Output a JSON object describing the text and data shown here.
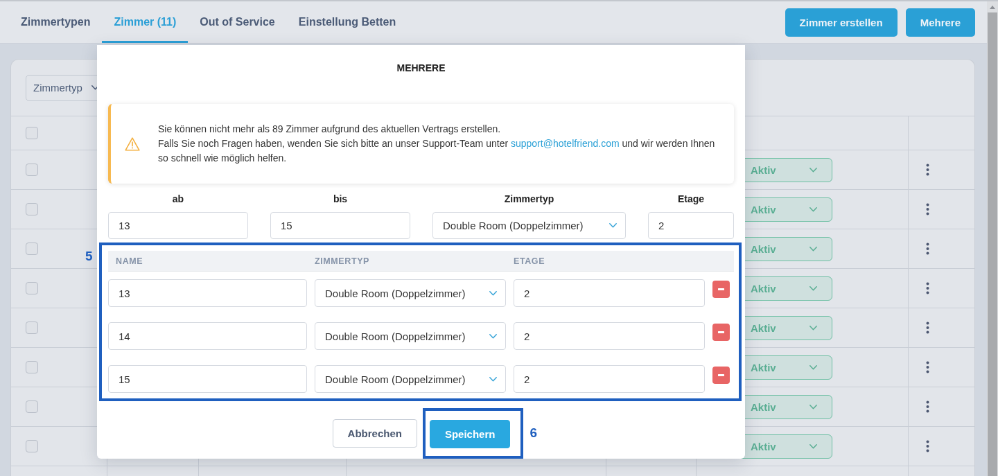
{
  "tabs": [
    {
      "label": "Zimmertypen",
      "selected": false
    },
    {
      "label": "Zimmer (11)",
      "selected": true
    },
    {
      "label": "Out of Service",
      "selected": false
    },
    {
      "label": "Einstellung Betten",
      "selected": false
    }
  ],
  "header_buttons": [
    {
      "label": "Zimmer erstellen"
    },
    {
      "label": "Mehrere"
    }
  ],
  "filter": {
    "label": "Zimmertyp"
  },
  "table": {
    "header_checkbox": {
      "checked": false
    },
    "rows": [
      {
        "checked": false,
        "status": "Aktiv"
      },
      {
        "checked": false,
        "status": "Aktiv"
      },
      {
        "checked": false,
        "status": "Aktiv"
      },
      {
        "checked": false,
        "status": "Aktiv"
      },
      {
        "checked": false,
        "status": "Aktiv"
      },
      {
        "checked": false,
        "status": "Aktiv"
      },
      {
        "checked": false,
        "status": "Aktiv"
      },
      {
        "checked": false,
        "status": "Aktiv"
      }
    ]
  },
  "dialog": {
    "title": "MEHRERE",
    "alert": {
      "message": "Sie können nicht mehr als 89 Zimmer aufgrund des aktuellen Vertrags erstellen.",
      "note": {
        "before": "Falls Sie noch Fragen haben, wenden Sie sich bitte an unser Support-Team unter",
        "link": "support@hotelfriend.com",
        "after": "und wir werden Ihnen so schnell wie möglich helfen."
      }
    },
    "range": [
      {
        "label": "ab",
        "value": "13",
        "kind": "input"
      },
      {
        "label": "bis",
        "value": "15",
        "kind": "input"
      },
      {
        "label": "Zimmertyp",
        "value": "Double Room (Doppelzimmer)",
        "kind": "select"
      },
      {
        "label": "Etage",
        "value": "2",
        "kind": "input"
      }
    ],
    "rooms": {
      "columns": [
        "NAME",
        "ZIMMERTYP",
        "ETAGE"
      ],
      "rows": [
        {
          "name": "13",
          "room_type": "Double Room (Doppelzimmer)",
          "floor": "2"
        },
        {
          "name": "14",
          "room_type": "Double Room (Doppelzimmer)",
          "floor": "2"
        },
        {
          "name": "15",
          "room_type": "Double Room (Doppelzimmer)",
          "floor": "2"
        }
      ]
    },
    "buttons": [
      {
        "label": "Abbrechen",
        "kind": "secondary"
      },
      {
        "label": "Speichern",
        "kind": "primary"
      }
    ]
  },
  "annotations": [
    {
      "label": "5"
    },
    {
      "label": "6"
    }
  ]
}
